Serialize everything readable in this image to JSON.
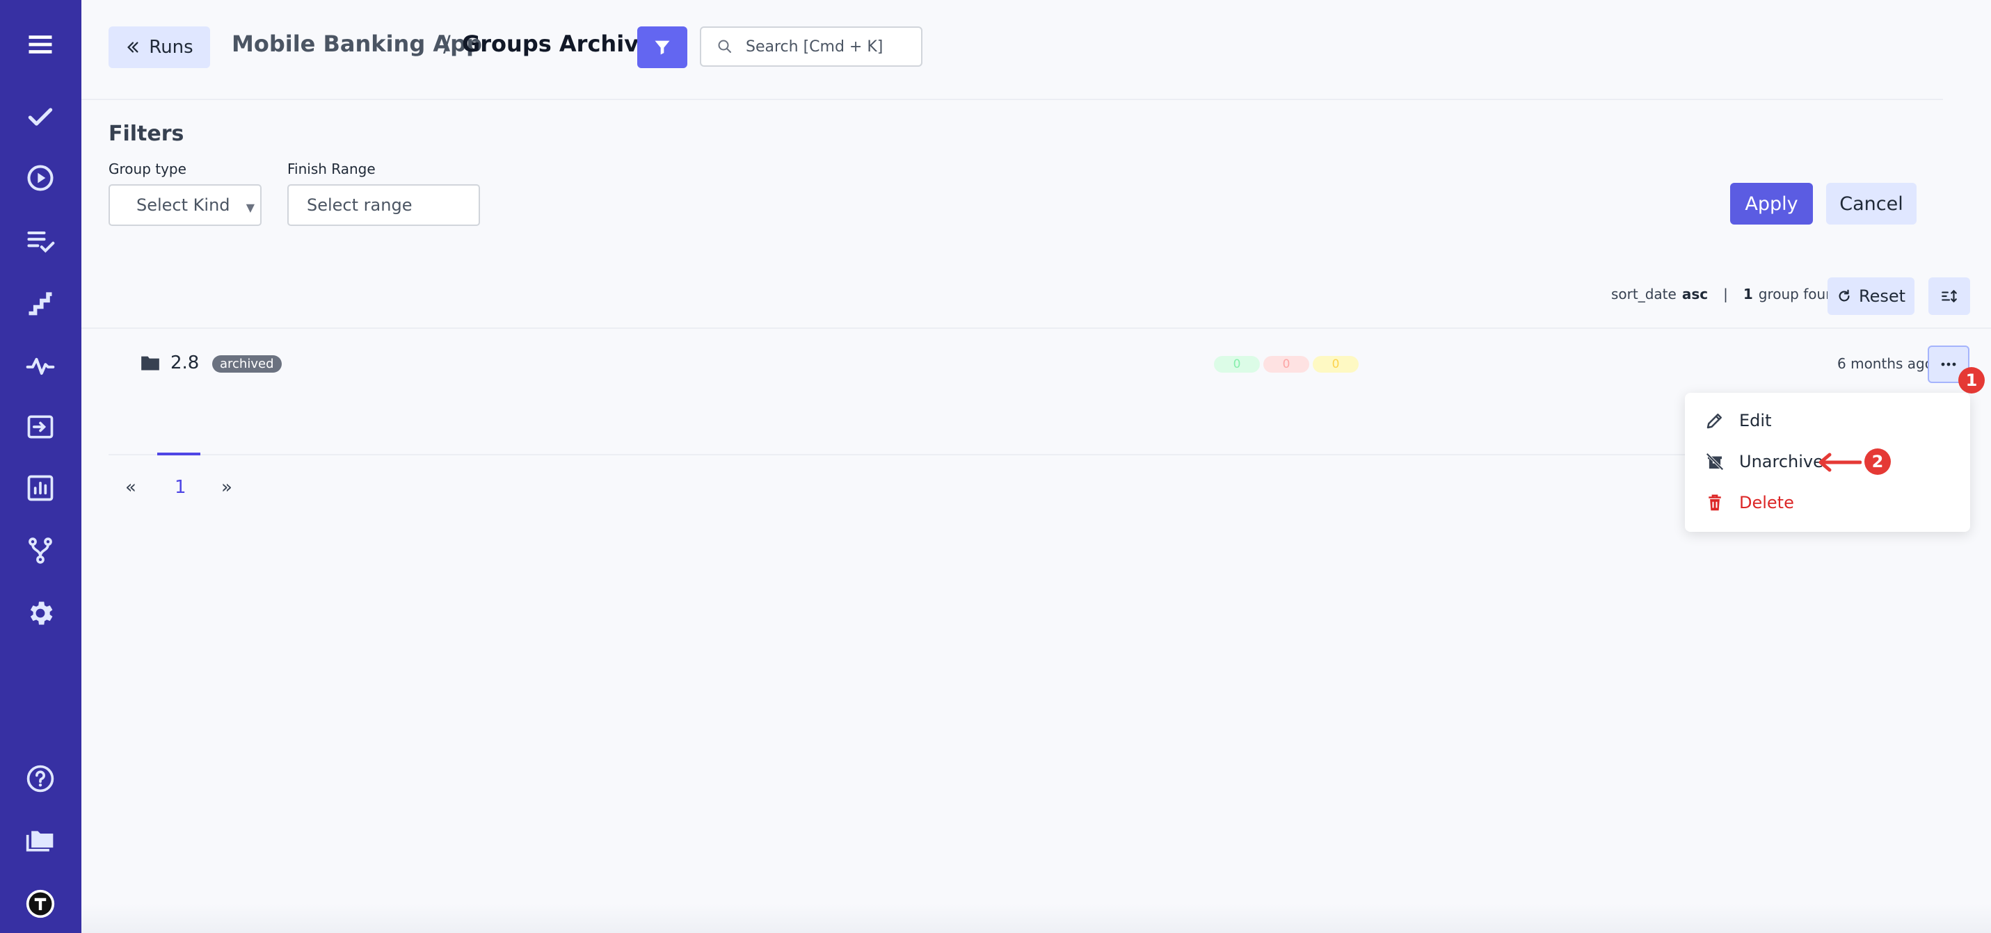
{
  "header": {
    "back_label": "Runs",
    "project": "Mobile Banking App",
    "separator": "/",
    "page_title": "Groups Archive",
    "search_placeholder": "Search [Cmd + K]"
  },
  "filters": {
    "title": "Filters",
    "group_type_label": "Group type",
    "group_type_value": "Select Kind",
    "finish_range_label": "Finish Range",
    "finish_range_value": "Select range",
    "apply_label": "Apply",
    "cancel_label": "Cancel"
  },
  "sort": {
    "field": "sort_date",
    "direction": "asc",
    "separator": "|",
    "count": "1",
    "found_label": "group found",
    "reset_label": "Reset"
  },
  "group": {
    "name": "2.8",
    "badge": "archived",
    "passed": "0",
    "failed": "0",
    "skipped": "0",
    "time_ago": "6 months ago"
  },
  "pagination": {
    "prev": "«",
    "current": "1",
    "next": "»"
  },
  "menu": {
    "edit": "Edit",
    "unarchive": "Unarchive",
    "delete": "Delete"
  },
  "annotations": {
    "step1": "1",
    "step2": "2"
  },
  "colors": {
    "sidebar": "#3730a3",
    "accent": "#6366f1",
    "annotation": "#e53935",
    "danger": "#dc2626"
  }
}
